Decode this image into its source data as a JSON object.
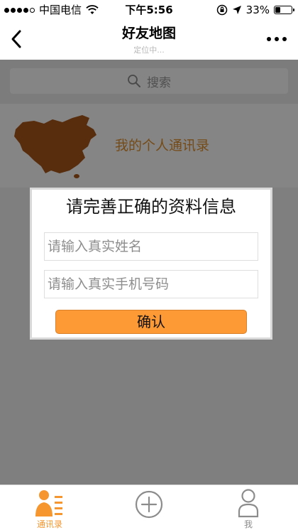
{
  "status_bar": {
    "carrier": "中国电信",
    "time": "下午5:56",
    "battery": "33%",
    "battery_level": 0.33
  },
  "nav": {
    "title": "好友地图",
    "subtitle": "定位中..."
  },
  "search": {
    "placeholder": "搜索"
  },
  "contact_entry": {
    "label": "我的个人通讯录"
  },
  "dialog": {
    "title": "请完善正确的资料信息",
    "name_placeholder": "请输入真实姓名",
    "phone_placeholder": "请输入真实手机号码",
    "confirm_label": "确认"
  },
  "tab_bar": {
    "items": [
      {
        "label": "通讯录",
        "icon": "contacts-icon",
        "active": true
      },
      {
        "label": "",
        "icon": "add-circle-icon",
        "active": false
      },
      {
        "label": "我",
        "icon": "person-icon",
        "active": false
      }
    ]
  },
  "colors": {
    "accent": "#fd9a35",
    "contact_label": "#e0902e",
    "map_fill": "#a8561a"
  }
}
